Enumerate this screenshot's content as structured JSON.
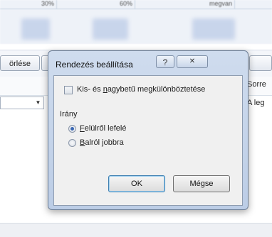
{
  "background": {
    "grid_cells": [
      "30%",
      "60%",
      "megvan"
    ],
    "toolbar_button": "örlése",
    "header_right": "Sorre",
    "row_right": "A leg"
  },
  "dialog": {
    "title": "Rendezés beállítása",
    "help_glyph": "?",
    "close_glyph": "✕",
    "case_checkbox": {
      "label_before": "Kis- és ",
      "label_mnemonic": "n",
      "label_after": "agybetű megkülönböztetése",
      "checked": false
    },
    "direction": {
      "label": "Irány",
      "options": [
        {
          "mnemonic": "F",
          "rest": "elülről lefelé",
          "selected": true
        },
        {
          "mnemonic": "B",
          "rest": "alról jobbra",
          "selected": false
        }
      ]
    },
    "ok_label": "OK",
    "cancel_label": "Mégse"
  }
}
